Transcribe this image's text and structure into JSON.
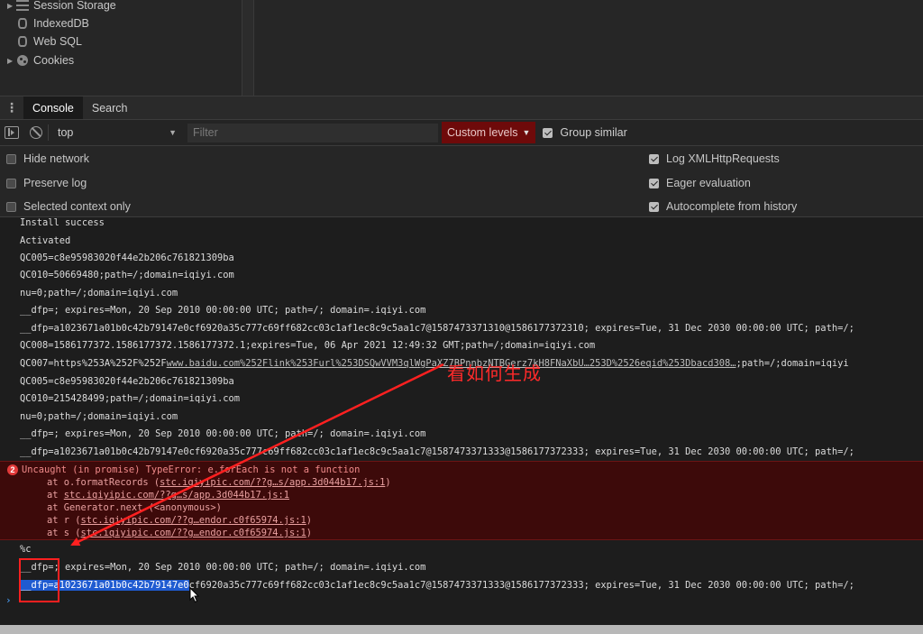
{
  "storage_tree": {
    "items": [
      {
        "label": "Session Storage",
        "icon": "table-grid-icon",
        "expandable": true
      },
      {
        "label": "IndexedDB",
        "icon": "database-icon",
        "expandable": false
      },
      {
        "label": "Web SQL",
        "icon": "database-icon",
        "expandable": false
      },
      {
        "label": "Cookies",
        "icon": "cookie-icon",
        "expandable": true
      }
    ]
  },
  "drawer": {
    "tabs": [
      {
        "label": "Console",
        "active": true
      },
      {
        "label": "Search",
        "active": false
      }
    ]
  },
  "toolbar": {
    "context": "top",
    "filter_placeholder": "Filter",
    "custom_levels": "Custom levels",
    "group_similar": "Group similar",
    "group_similar_checked": true
  },
  "settings": {
    "left": [
      {
        "label": "Hide network",
        "checked": false
      },
      {
        "label": "Preserve log",
        "checked": false
      },
      {
        "label": "Selected context only",
        "checked": false
      }
    ],
    "right": [
      {
        "label": "Log XMLHttpRequests",
        "checked": true
      },
      {
        "label": "Eager evaluation",
        "checked": true
      },
      {
        "label": "Autocomplete from history",
        "checked": true
      }
    ]
  },
  "console": {
    "lines": [
      "Install success",
      "Activated",
      "QC005=c8e95983020f44e2b206c761821309ba",
      "QC010=50669480;path=/;domain=iqiyi.com",
      "nu=0;path=/;domain=iqiyi.com",
      "__dfp=; expires=Mon, 20 Sep 2010 00:00:00 UTC; path=/; domain=.iqiyi.com",
      "__dfp=a1023671a01b0c42b79147e0cf6920a35c777c69ff682cc03c1af1ec8c9c5aa1c7@1587473371310@1586177372310; expires=Tue, 31 Dec 2030 00:00:00 UTC; path=/;",
      "QC008=1586177372.1586177372.1586177372.1;expires=Tue, 06 Apr 2021 12:49:32 GMT;path=/;domain=iqiyi.com",
      "QC005=c8e95983020f44e2b206c761821309ba",
      "QC010=215428499;path=/;domain=iqiyi.com",
      "nu=0;path=/;domain=iqiyi.com",
      "__dfp=; expires=Mon, 20 Sep 2010 00:00:00 UTC; path=/; domain=.iqiyi.com",
      "__dfp=a1023671a01b0c42b79147e0cf6920a35c777c69ff682cc03c1af1ec8c9c5aa1c7@1587473371333@1586177372333; expires=Tue, 31 Dec 2030 00:00:00 UTC; path=/;"
    ],
    "qc007": {
      "prefix": "QC007=https%253A%252F%252F",
      "link": "www.baidu.com%252Flink%253Furl%253DSQwVVM3qlWgPaXZ7BPnnbzNTBGerz7kH8FNaXbU…253D%2526eqid%253Dbacd308…",
      "suffix": ";path=/;domain=iqiyi"
    },
    "error": {
      "message": "Uncaught (in promise) TypeError: e.forEach is not a function",
      "count": "2",
      "stack": [
        {
          "pre": "at o.formatRecords (",
          "link": "stc.iqiyipic.com/??g…s/app.3d044b17.js:1",
          "post": ")"
        },
        {
          "pre": "at ",
          "link": "stc.iqiyipic.com/??g…s/app.3d044b17.js:1",
          "post": ""
        },
        {
          "pre": "at Generator.next (<anonymous>)",
          "link": "",
          "post": ""
        },
        {
          "pre": "at r (",
          "link": "stc.iqiyipic.com/??g…endor.c0f65974.js:1",
          "post": ")"
        },
        {
          "pre": "at s (",
          "link": "stc.iqiyipic.com/??g…endor.c0f65974.js:1",
          "post": ")"
        }
      ]
    },
    "after_error": [
      "%c",
      "__dfp=; expires=Mon, 20 Sep 2010 00:00:00 UTC; path=/; domain=.iqiyi.com"
    ],
    "selected_line": {
      "selected": "__dfp=a1023671a01b0c42b79147e0",
      "rest": "cf6920a35c777c69ff682cc03c1af1ec8c9c5aa1c7@1587473371333@1586177372333; expires=Tue, 31 Dec 2030 00:00:00 UTC; path=/;"
    },
    "prompt": "›"
  },
  "annotation": {
    "text": "看如何生成",
    "color": "#ff2020"
  },
  "colors": {
    "custom_levels_bg": "#6e0a0a",
    "error_bg": "#3d0a0a",
    "selection": "#1f5bd1"
  }
}
